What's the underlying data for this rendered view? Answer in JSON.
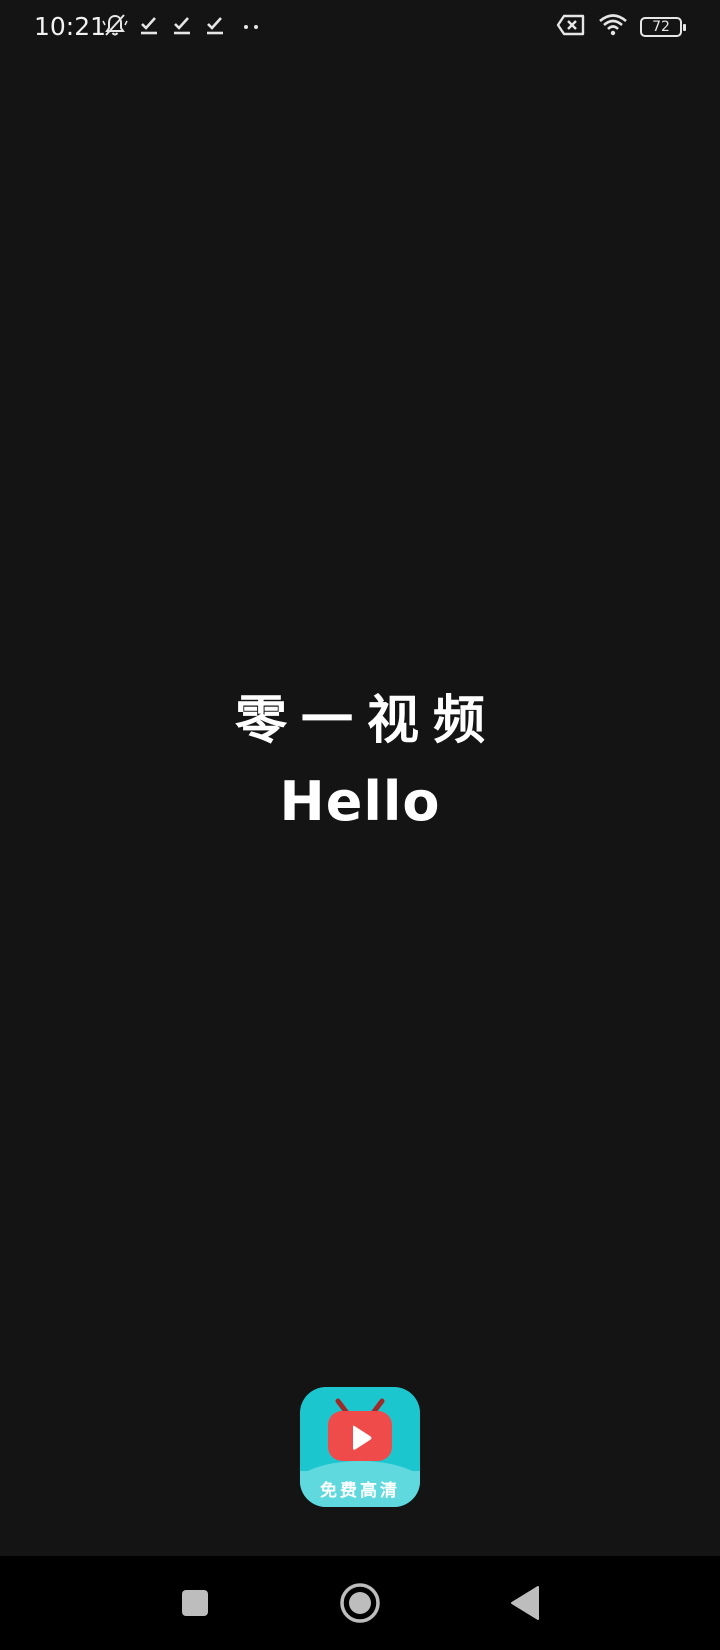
{
  "status_bar": {
    "time": "10:21",
    "left_icons": [
      "notifications-muted-icon",
      "check-icon",
      "check-icon",
      "check-icon",
      "more-dots-icon"
    ],
    "right_icons": [
      "sim-off-icon",
      "wifi-icon",
      "battery-icon"
    ],
    "battery_level": "72"
  },
  "splash": {
    "title": "零一视频",
    "subtitle": "Hello"
  },
  "app_logo": {
    "caption": "免费高清",
    "colors": {
      "tile": "#1cc6cf",
      "band": "#5fd9de",
      "tv": "#f04b4b",
      "antenna": "#9e2a2a"
    }
  },
  "nav_bar": {
    "buttons": [
      "recents-icon",
      "home-icon",
      "back-icon"
    ]
  },
  "colors": {
    "background": "#141414",
    "nav_background": "#000000",
    "text": "#ffffff"
  }
}
